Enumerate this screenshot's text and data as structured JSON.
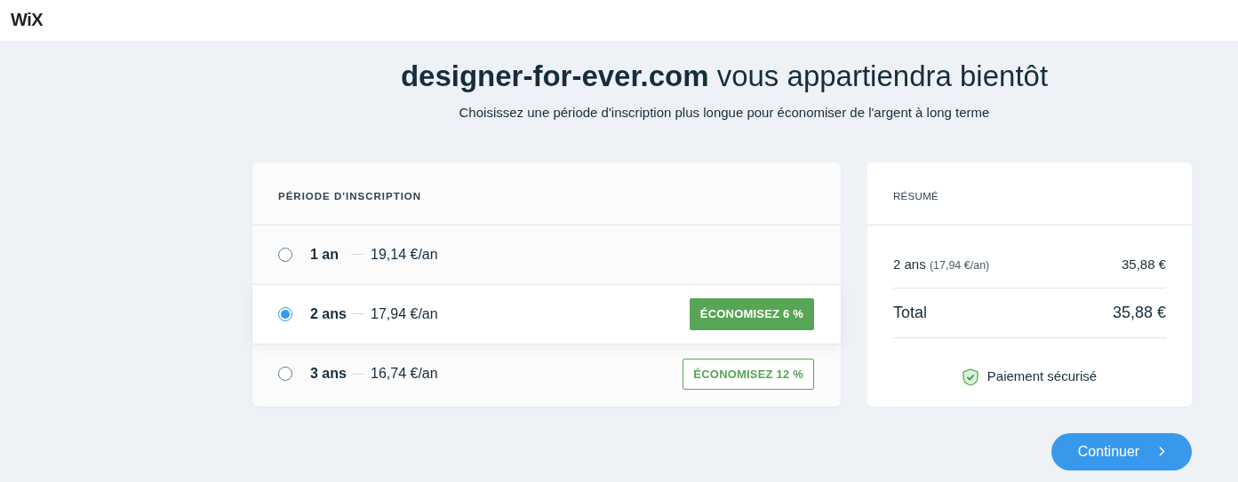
{
  "header": {
    "logo": "WiX"
  },
  "heading": {
    "title": "**designer-for-ever.com** vous appartiendra bientôt",
    "subtitle": "Choisissez une période d'inscription plus longue pour économiser de l'argent à long terme"
  },
  "period_card": {
    "title": "PÉRIODE D'INSCRIPTION",
    "options": [
      {
        "term": "1 an",
        "price": "19,14 €/an",
        "selected": false
      },
      {
        "term": "2 ans",
        "price": "17,94 €/an",
        "selected": true,
        "badge": {
          "text": "ÉCONOMISEZ 6 %",
          "kind": "filled"
        }
      },
      {
        "term": "3 ans",
        "price": "16,74 €/an",
        "selected": false,
        "badge": {
          "text": "ÉCONOMISEZ 12 %",
          "kind": "outline"
        }
      }
    ]
  },
  "summary": {
    "title": "RÉSUMÉ",
    "line": {
      "label": "2 ans",
      "detail": "(17,94 €/an)",
      "amount": "35,88 €"
    },
    "total": {
      "label": "Total",
      "amount": "35,88 €"
    },
    "secure": "Paiement sécurisé"
  },
  "continue_button": "Continuer"
}
